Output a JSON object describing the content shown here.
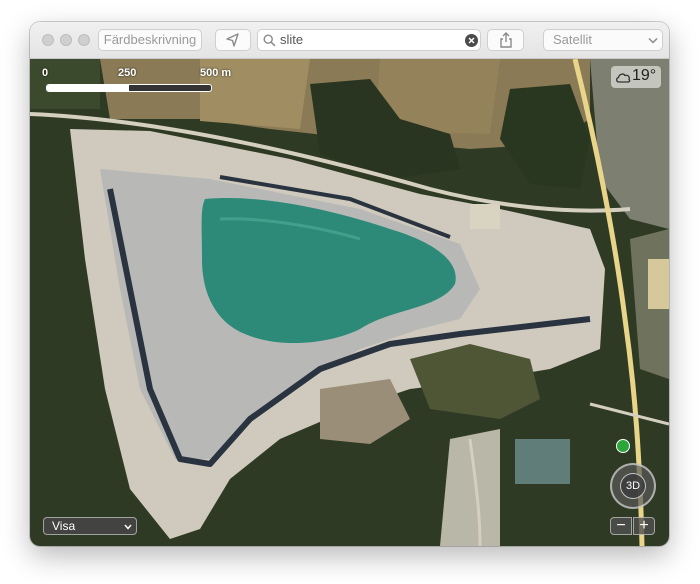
{
  "toolbar": {
    "directions_label": "Färdbeskrivning",
    "search_value": "slite",
    "map_type": "Satellit"
  },
  "map": {
    "scale": {
      "tick_0": "0",
      "tick_1": "250",
      "tick_2": "500 m"
    },
    "weather": {
      "temperature": "19°",
      "icon": "cloud-icon"
    },
    "compass_label": "3D",
    "show_menu_label": "Visa",
    "zoom_out_label": "−",
    "zoom_in_label": "+"
  },
  "colors": {
    "quarry_water": "#2d8a78",
    "road": "#e8d58a",
    "forest": "#2f3d25"
  }
}
